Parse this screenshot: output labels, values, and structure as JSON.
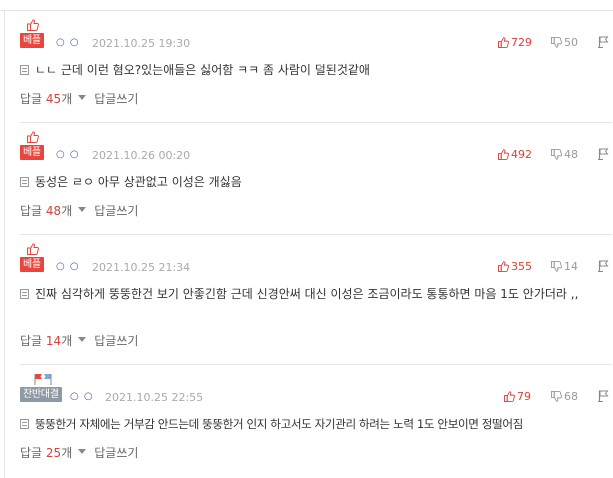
{
  "comments": [
    {
      "badge": "베플",
      "circles": "○ ○",
      "date": "2021.10.25 19:30",
      "likes": "729",
      "dislikes": "50",
      "text": "ㄴㄴ 근데 이런 혐오?있는애들은 싫어함 ㅋㅋ 좀 사람이 덜된것같애",
      "reply_label": "답글",
      "reply_count": "45",
      "reply_unit": "개",
      "write_label": "답글쓰기"
    },
    {
      "badge": "베플",
      "circles": "○ ○",
      "date": "2021.10.26 00:20",
      "likes": "492",
      "dislikes": "48",
      "text": "동성은 ㄹㅇ 아무 상관없고 이성은 개싫음",
      "reply_label": "답글",
      "reply_count": "48",
      "reply_unit": "개",
      "write_label": "답글쓰기"
    },
    {
      "badge": "베플",
      "circles": "○ ○",
      "date": "2021.10.25 21:34",
      "likes": "355",
      "dislikes": "14",
      "text": "진짜 심각하게 뚱뚱한건 보기 안좋긴함 근데 신경안써 대신 이성은 조금이라도 통통하면 마음 1도 안가더라 ,,",
      "reply_label": "답글",
      "reply_count": "14",
      "reply_unit": "개",
      "write_label": "답글쓰기"
    },
    {
      "badge": "찬반대결",
      "circles": "○ ○",
      "date": "2021.10.25 22:55",
      "likes": "79",
      "dislikes": "68",
      "text": "뚱뚱한거 자체에는 거부감 안드는데 뚱뚱한거 인지 하고서도 자기관리 하려는 노력 1도 안보이면 정떨어짐",
      "reply_label": "답글",
      "reply_count": "25",
      "reply_unit": "개",
      "write_label": "답글쓰기"
    }
  ],
  "colors": {
    "badge_red": "#e8463a",
    "badge_gray": "#8e99a4",
    "like_red": "#d9413a",
    "nick_blue": "#3d5ac0"
  },
  "icons": {
    "best": "thumbs-up-icon",
    "versus": "flags-icon",
    "like": "thumbs-up-icon",
    "dislike": "thumbs-down-icon",
    "report": "flag-icon",
    "memo": "memo-icon"
  }
}
